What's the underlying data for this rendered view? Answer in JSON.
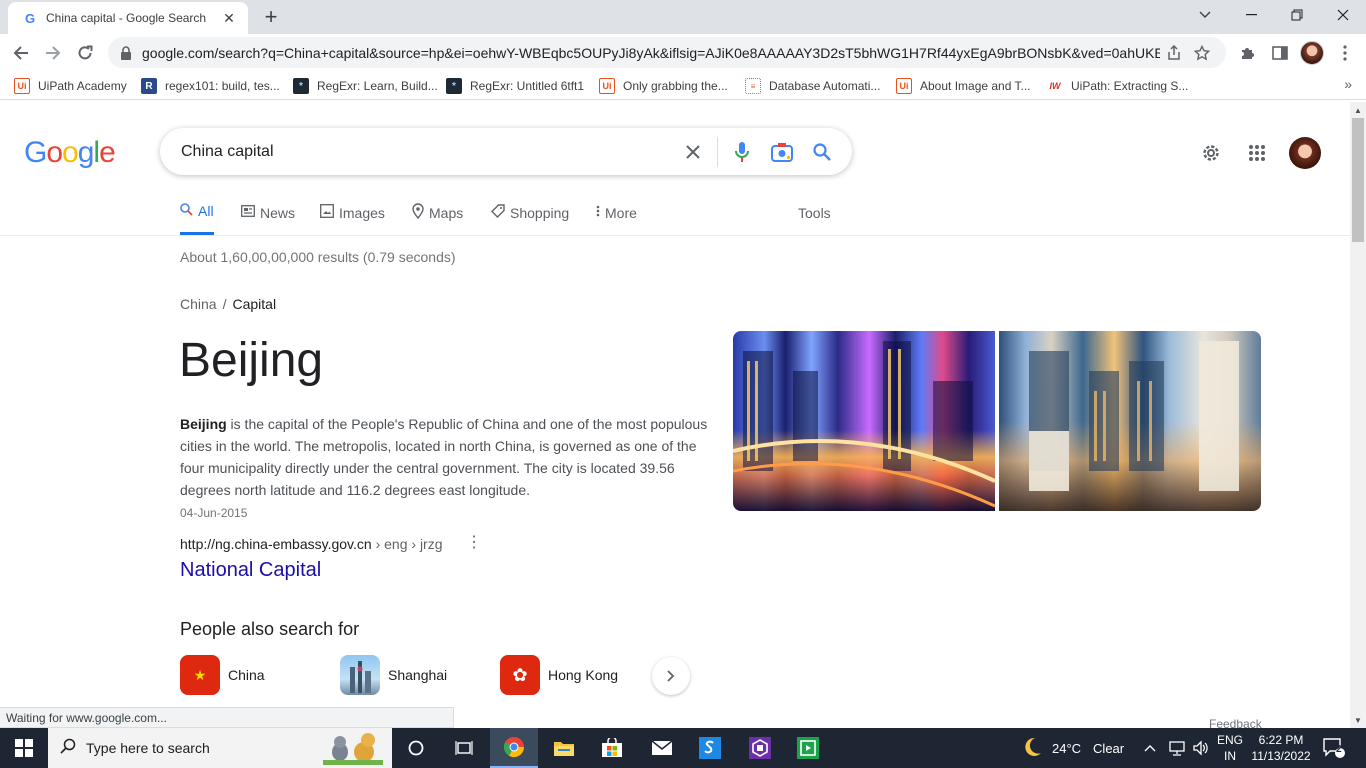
{
  "browser": {
    "tab_title": "China capital - Google Search",
    "new_tab": "+",
    "url": "google.com/search?q=China+capital&source=hp&ei=oehwY-WBEqbc5OUPyJi8yAk&iflsig=AJiK0e8AAAAAY3D2sT5bhWG1H7Rf44yxEgA9brBONsbK&ved=0ahUKE...",
    "status_text": "Waiting for www.google.com...",
    "bookmarks": [
      {
        "label": "UiPath Academy",
        "icon": "uipath-icon"
      },
      {
        "label": "regex101: build, tes...",
        "icon": "regex101-icon"
      },
      {
        "label": "RegExr: Learn, Build...",
        "icon": "regexr-icon"
      },
      {
        "label": "RegExr: Untitled 6tft1",
        "icon": "regexr-icon"
      },
      {
        "label": "Only grabbing the...",
        "icon": "uipath-icon"
      },
      {
        "label": "Database Automati...",
        "icon": "database-icon"
      },
      {
        "label": "About Image and T...",
        "icon": "uipath-icon"
      },
      {
        "label": "UiPath: Extracting S...",
        "icon": "iw-icon"
      }
    ]
  },
  "google": {
    "logo": [
      "G",
      "o",
      "o",
      "g",
      "l",
      "e"
    ],
    "logo_colors": [
      "#4285f4",
      "#ea4335",
      "#fbbc05",
      "#4285f4",
      "#34a853",
      "#ea4335"
    ],
    "query": "China capital",
    "tabs": [
      {
        "label": "All",
        "icon": "search-icon"
      },
      {
        "label": "News",
        "icon": "news-icon"
      },
      {
        "label": "Images",
        "icon": "image-icon"
      },
      {
        "label": "Maps",
        "icon": "map-pin-icon"
      },
      {
        "label": "Shopping",
        "icon": "tag-icon"
      },
      {
        "label": "More",
        "icon": "more-vertical-icon"
      }
    ],
    "tools": "Tools",
    "result_stats": "About 1,60,00,00,000 results (0.79 seconds)",
    "breadcrumb": {
      "parent": "China",
      "separator": "/",
      "current": "Capital"
    },
    "answer": "Beijing",
    "description_bold": "Beijing",
    "description": " is the capital of the People's Republic of China and one of the most populous cities in the world. The metropolis, located in north China, is governed as one of the four municipality directly under the central government. The city is located 39.56 degrees north latitude and 116.2 degrees east longitude.",
    "date": "04-Jun-2015",
    "source_url_domain": "http://ng.china-embassy.gov.cn",
    "source_url_path": " › eng › jrzg",
    "source_title": "National Capital",
    "people_also_search_title": "People also search for",
    "people_also_search": [
      {
        "label": "China"
      },
      {
        "label": "Shanghai"
      },
      {
        "label": "Hong Kong"
      }
    ],
    "feedback": "Feedback"
  },
  "taskbar": {
    "search_placeholder": "Type here to search",
    "weather_temp": "24°C",
    "weather_desc": "Clear",
    "lang_top": "ENG",
    "lang_bottom": "IN",
    "time": "6:22 PM",
    "date": "11/13/2022",
    "notification_count": "2"
  }
}
